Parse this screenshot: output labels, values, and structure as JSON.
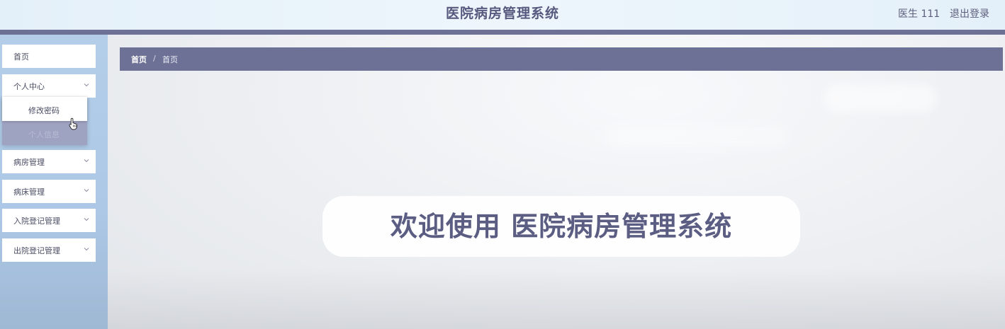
{
  "header": {
    "title": "医院病房管理系统",
    "user_name": "医生 111",
    "logout_label": "退出登录"
  },
  "sidebar": {
    "items": [
      {
        "label": "首页",
        "has_submenu": false
      },
      {
        "label": "个人中心",
        "has_submenu": true,
        "expanded": true
      },
      {
        "label": "病房管理",
        "has_submenu": true
      },
      {
        "label": "病床管理",
        "has_submenu": true
      },
      {
        "label": "入院登记管理",
        "has_submenu": true
      },
      {
        "label": "出院登记管理",
        "has_submenu": true
      }
    ],
    "personal_center_submenu": [
      {
        "label": "修改密码"
      },
      {
        "label": "个人信息"
      }
    ]
  },
  "breadcrumb": {
    "first": "首页",
    "separator": "/",
    "current": "首页"
  },
  "welcome": {
    "text": "欢迎使用 医院病房管理系统"
  },
  "colors": {
    "accent": "#6e7196",
    "sidebar_bg": "#acc8e6",
    "title_text": "#58597e"
  },
  "icons": {
    "chevron": "chevron-down-icon",
    "cursor": "hand-pointer-icon"
  }
}
